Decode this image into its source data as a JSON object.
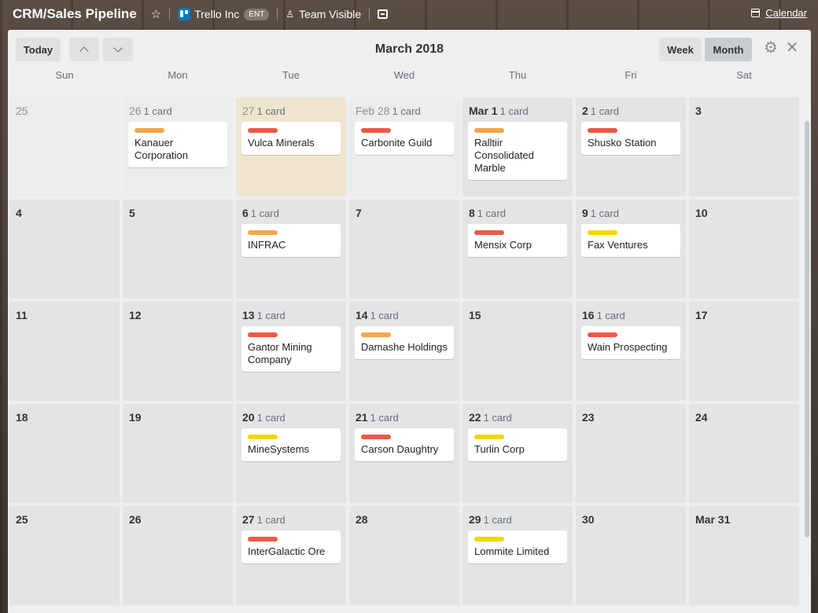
{
  "header": {
    "board_title": "CRM/Sales Pipeline",
    "org_name": "Trello Inc",
    "org_badge": "ENT",
    "visibility": "Team Visible",
    "calendar_link": "Calendar"
  },
  "toolbar": {
    "today": "Today",
    "title": "March 2018",
    "week": "Week",
    "month": "Month",
    "gear_glyph": "⚙",
    "close_glyph": "✕"
  },
  "colors": {
    "orange": "#f6a64a",
    "red": "#eb5a46",
    "yellow": "#f2d600"
  },
  "days_of_week": [
    "Sun",
    "Mon",
    "Tue",
    "Wed",
    "Thu",
    "Fri",
    "Sat"
  ],
  "weeks": [
    [
      {
        "day": "25",
        "outside": true
      },
      {
        "day": "26",
        "count": "1 card",
        "outside": true,
        "card": {
          "title": "Kanauer Corporation",
          "label": "orange"
        }
      },
      {
        "day": "27",
        "count": "1 card",
        "outside": true,
        "today": true,
        "card": {
          "title": "Vulca Minerals",
          "label": "red"
        }
      },
      {
        "day": "Feb 28",
        "count": "1 card",
        "outside": true,
        "card": {
          "title": "Carbonite Guild",
          "label": "red"
        }
      },
      {
        "day": "Mar 1",
        "count": "1 card",
        "card": {
          "title": "Ralltiir Consolidated Marble",
          "label": "orange"
        }
      },
      {
        "day": "2",
        "count": "1 card",
        "card": {
          "title": "Shusko Station",
          "label": "red"
        }
      },
      {
        "day": "3"
      }
    ],
    [
      {
        "day": "4"
      },
      {
        "day": "5"
      },
      {
        "day": "6",
        "count": "1 card",
        "card": {
          "title": "INFRAC",
          "label": "orange"
        }
      },
      {
        "day": "7"
      },
      {
        "day": "8",
        "count": "1 card",
        "card": {
          "title": "Mensix Corp",
          "label": "red"
        }
      },
      {
        "day": "9",
        "count": "1 card",
        "card": {
          "title": "Fax Ventures",
          "label": "yellow"
        }
      },
      {
        "day": "10"
      }
    ],
    [
      {
        "day": "11"
      },
      {
        "day": "12"
      },
      {
        "day": "13",
        "count": "1 card",
        "card": {
          "title": "Gantor Mining Company",
          "label": "red"
        }
      },
      {
        "day": "14",
        "count": "1 card",
        "card": {
          "title": "Damashe Holdings",
          "label": "orange"
        }
      },
      {
        "day": "15"
      },
      {
        "day": "16",
        "count": "1 card",
        "card": {
          "title": "Wain Prospecting",
          "label": "red"
        }
      },
      {
        "day": "17"
      }
    ],
    [
      {
        "day": "18"
      },
      {
        "day": "19"
      },
      {
        "day": "20",
        "count": "1 card",
        "card": {
          "title": "MineSystems",
          "label": "yellow"
        }
      },
      {
        "day": "21",
        "count": "1 card",
        "card": {
          "title": "Carson Daughtry",
          "label": "red"
        }
      },
      {
        "day": "22",
        "count": "1 card",
        "card": {
          "title": "Turlin Corp",
          "label": "yellow"
        }
      },
      {
        "day": "23"
      },
      {
        "day": "24"
      }
    ],
    [
      {
        "day": "25"
      },
      {
        "day": "26"
      },
      {
        "day": "27",
        "count": "1 card",
        "card": {
          "title": "InterGalactic Ore",
          "label": "red"
        }
      },
      {
        "day": "28"
      },
      {
        "day": "29",
        "count": "1 card",
        "card": {
          "title": "Lommite Limited",
          "label": "yellow"
        }
      },
      {
        "day": "30"
      },
      {
        "day": "Mar 31"
      }
    ]
  ]
}
